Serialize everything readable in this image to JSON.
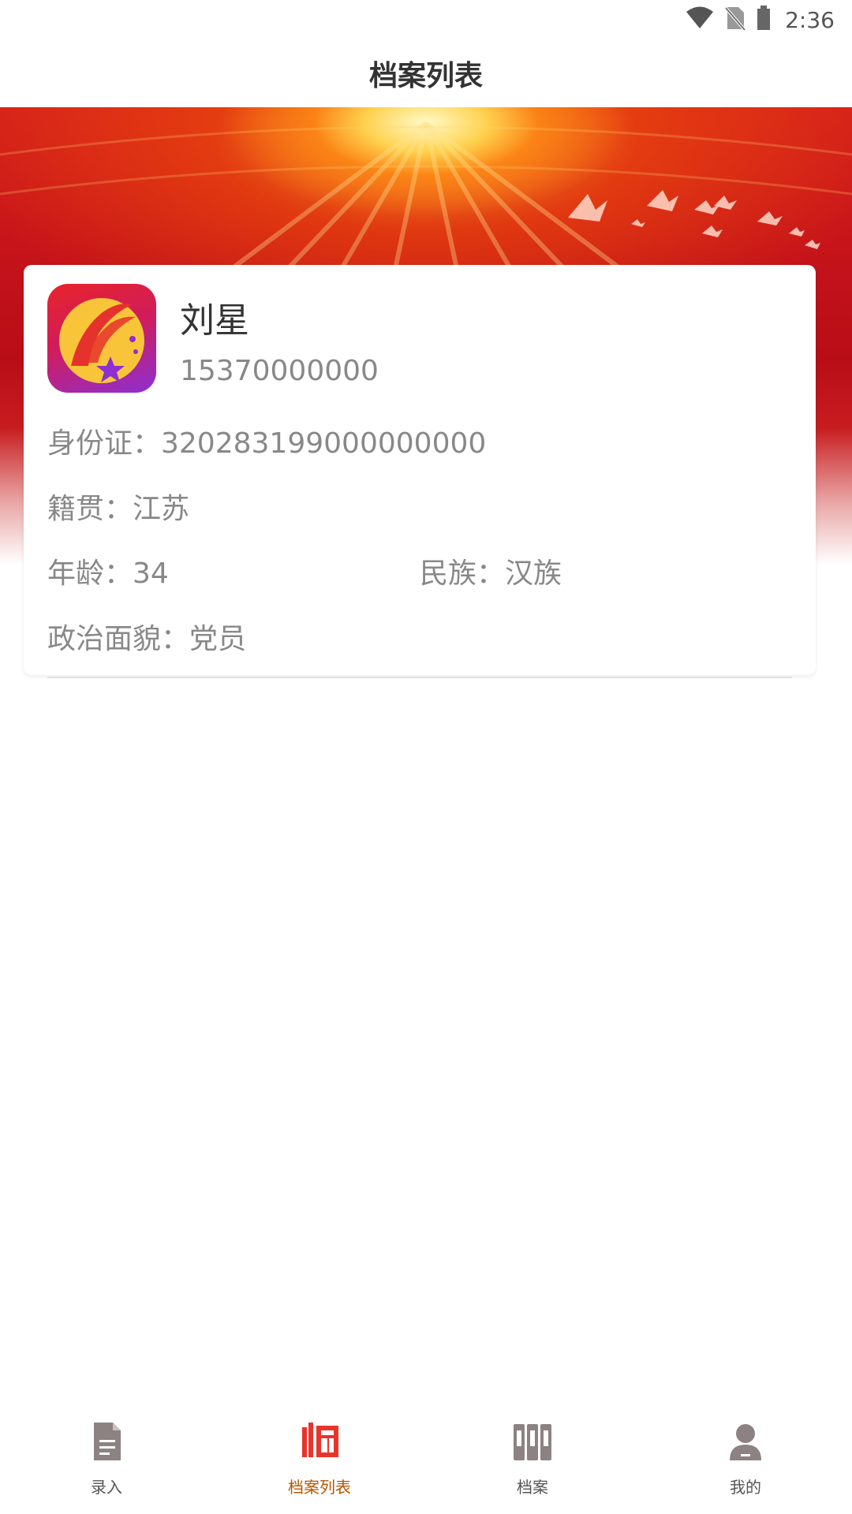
{
  "status_bar": {
    "time": "2:36",
    "icons": [
      "wifi-icon",
      "no-sim-icon",
      "battery-icon"
    ]
  },
  "header": {
    "title": "档案列表"
  },
  "record": {
    "name": "刘星",
    "phone": "15370000000",
    "id_card": "身份证：320283199000000000",
    "native_place": "籍贯：江苏",
    "age": "年龄：34",
    "ethnicity": "民族：汉族",
    "political_status": "政治面貌：党员"
  },
  "bottom_nav": {
    "items": [
      {
        "label": "录入",
        "icon": "document-icon",
        "active": false
      },
      {
        "label": "档案列表",
        "icon": "list-icon",
        "active": true
      },
      {
        "label": "档案",
        "icon": "archive-icon",
        "active": false
      },
      {
        "label": "我的",
        "icon": "user-icon",
        "active": false
      }
    ]
  },
  "colors": {
    "accent": "#e8342a",
    "active_label": "#b45600",
    "inactive_icon": "#8c8282",
    "banner_red": "#c4121a"
  }
}
